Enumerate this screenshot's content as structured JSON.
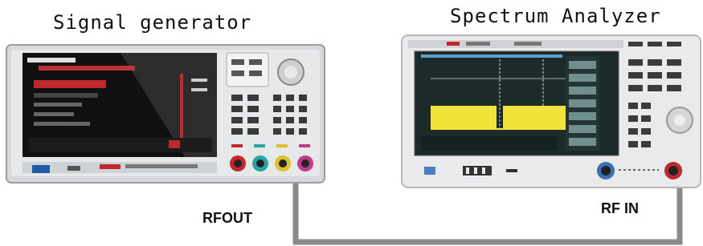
{
  "diagram": {
    "generator": {
      "title": "Signal generator",
      "output_label": "RFOUT"
    },
    "analyzer": {
      "title": "Spectrum Analyzer",
      "input_label": "RF IN"
    },
    "colors": {
      "cable": "#8a8a8a",
      "instrument_body": "#d7d9dc",
      "screen_dark": "#101010",
      "trace_yellow": "#f2e33a",
      "analyzer_screen": "#1d2a2a",
      "accent_red": "#c0282d",
      "accent_blue": "#1f5aa6"
    }
  }
}
